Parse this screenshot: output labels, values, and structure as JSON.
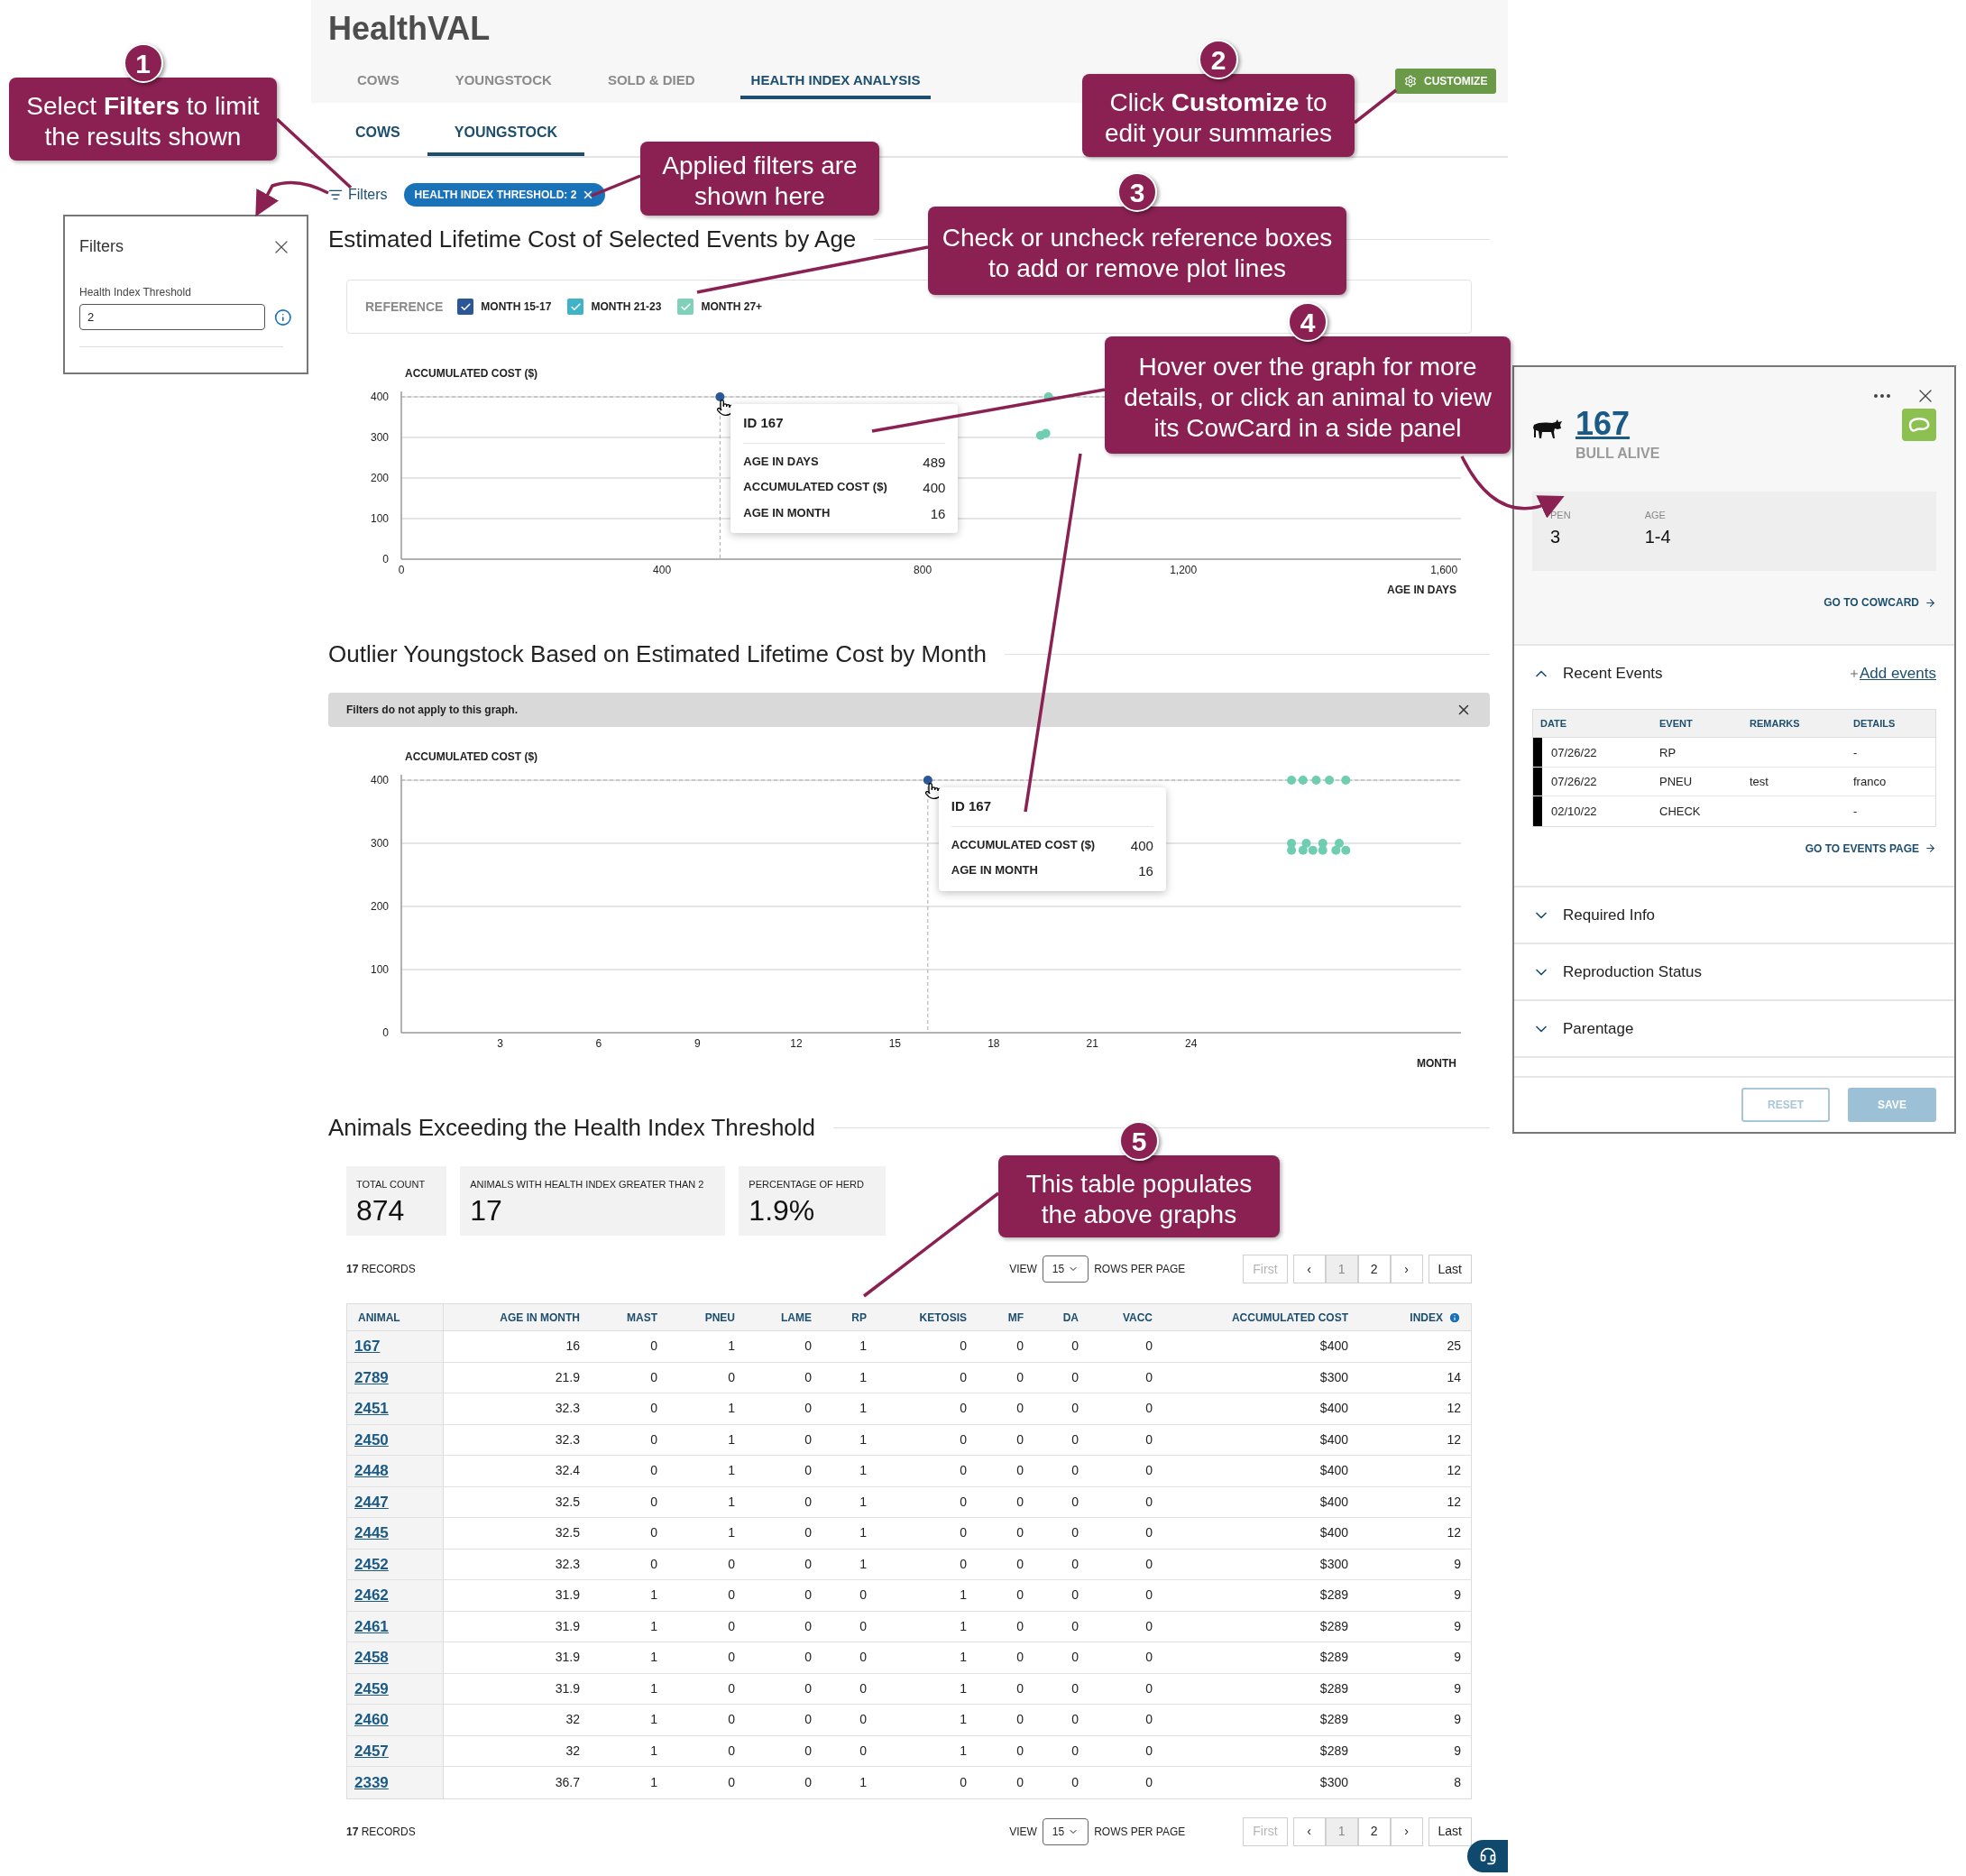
{
  "header": {
    "title": "HealthVAL",
    "customize": "CUSTOMIZE"
  },
  "tabs": [
    {
      "label": "COWS",
      "selected": false
    },
    {
      "label": "YOUNGSTOCK",
      "selected": false
    },
    {
      "label": "SOLD & DIED",
      "selected": false
    },
    {
      "label": "HEALTH INDEX ANALYSIS",
      "selected": true
    }
  ],
  "subtabs": [
    {
      "label": "COWS",
      "selected": false
    },
    {
      "label": "YOUNGSTOCK",
      "selected": true
    }
  ],
  "filter_bar": {
    "label": "Filters",
    "chips": [
      "HEALTH INDEX THRESHOLD: 2"
    ]
  },
  "filters_panel": {
    "title": "Filters",
    "field_label": "Health Index Threshold",
    "value": "2"
  },
  "age_chart": {
    "reference": {
      "label": "REFERENCE",
      "options": [
        {
          "label": "MONTH 15-17",
          "checked": true,
          "color": "#2b5797"
        },
        {
          "label": "MONTH 21-23",
          "checked": true,
          "color": "#3fb4c6"
        },
        {
          "label": "MONTH 27+",
          "checked": true,
          "color": "#7fd1b9"
        }
      ]
    },
    "chart_data": {
      "type": "scatter",
      "title": "Estimated Lifetime Cost of Selected Events by Age",
      "xlabel": "AGE IN DAYS",
      "ylabel": "ACCUMULATED COST ($)",
      "xlim": [
        0,
        1626
      ],
      "ylim": [
        0,
        400
      ],
      "grid": true,
      "ref_lines": [
        {
          "axis": "x",
          "value": 489
        },
        {
          "axis": "y",
          "value": 400
        }
      ],
      "xticks": [
        0,
        400,
        800,
        {
          "value": 1200,
          "label": "1,200"
        },
        {
          "value": 1600,
          "label": "1,600"
        }
      ],
      "yticks": [
        0,
        100,
        200,
        300,
        400
      ],
      "series": [
        {
          "color": "#2b5797",
          "x": [
            489
          ],
          "values": [
            400
          ]
        },
        {
          "color": "#6fcdb0",
          "x": [
            993,
            981,
            989
          ],
          "values": [
            400,
            305,
            310
          ]
        }
      ]
    },
    "tooltip": {
      "title": "ID 167",
      "rows": [
        {
          "label": "AGE IN DAYS",
          "value": "489"
        },
        {
          "label": "ACCUMULATED COST ($)",
          "value": "400"
        },
        {
          "label": "AGE IN MONTH",
          "value": "16"
        }
      ]
    }
  },
  "month_chart": {
    "notice": "Filters do not apply to this graph.",
    "chart_data": {
      "type": "scatter",
      "title": "Outlier Youngstock Based on Estimated Lifetime Cost by Month",
      "xlabel": "MONTH",
      "ylabel": "ACCUMULATED COST ($)",
      "xlim": [
        0,
        32.2
      ],
      "ylim": [
        0,
        400
      ],
      "grid": true,
      "ref_lines": [
        {
          "axis": "x",
          "value": 16
        },
        {
          "axis": "y",
          "value": 400
        }
      ],
      "xticks": [
        3,
        6,
        9,
        12,
        15,
        18,
        21,
        24
      ],
      "yticks": [
        0,
        100,
        200,
        300,
        400
      ],
      "series": [
        {
          "color": "#2b5797",
          "x": [
            16
          ],
          "values": [
            400
          ]
        },
        {
          "color": "#6fcdb0",
          "x": [
            27.05,
            27.4,
            27.8,
            28.2,
            28.7,
            27.05,
            27.5,
            28,
            28.5,
            27.05,
            27.4,
            27.7,
            28,
            28.4,
            28.7
          ],
          "values": [
            400,
            400,
            400,
            400,
            400,
            300,
            300,
            300,
            300,
            289,
            289,
            289,
            289,
            289,
            289
          ]
        }
      ]
    },
    "tooltip": {
      "title": "ID 167",
      "rows": [
        {
          "label": "ACCUMULATED COST ($)",
          "value": "400"
        },
        {
          "label": "AGE IN MONTH",
          "value": "16"
        }
      ]
    }
  },
  "threshold": {
    "title": "Animals Exceeding the Health Index Threshold",
    "stats": [
      {
        "label": "TOTAL COUNT",
        "value": "874"
      },
      {
        "label": "ANIMALS WITH HEALTH INDEX GREATER THAN 2",
        "value": "17"
      },
      {
        "label": "PERCENTAGE OF HERD",
        "value": "1.9%"
      }
    ],
    "pagers": [
      {
        "records": "**17** RECORDS",
        "view_label": "VIEW",
        "per_page": "15",
        "per_page_label": "ROWS PER PAGE",
        "buttons": [
          {
            "label": "First",
            "selected": false,
            "disabled": true
          },
          {
            "label": "‹",
            "selected": false,
            "disabled": false
          },
          {
            "label": "1",
            "selected": true,
            "disabled": false
          },
          {
            "label": "2",
            "selected": false,
            "disabled": false
          },
          {
            "label": "›",
            "selected": false,
            "disabled": false
          },
          {
            "label": "Last",
            "selected": false,
            "disabled": false
          }
        ]
      },
      {
        "records": "**17** RECORDS",
        "view_label": "VIEW",
        "per_page": "15",
        "per_page_label": "ROWS PER PAGE",
        "buttons": [
          {
            "label": "First",
            "selected": false,
            "disabled": true
          },
          {
            "label": "‹",
            "selected": false,
            "disabled": false
          },
          {
            "label": "1",
            "selected": true,
            "disabled": false
          },
          {
            "label": "2",
            "selected": false,
            "disabled": false
          },
          {
            "label": "›",
            "selected": false,
            "disabled": false
          },
          {
            "label": "Last",
            "selected": false,
            "disabled": false
          }
        ]
      }
    ],
    "columns": [
      "ANIMAL",
      "AGE IN MONTH",
      "MAST",
      "PNEU",
      "LAME",
      "RP",
      "KETOSIS",
      "MF",
      "DA",
      "VACC",
      "ACCUMULATED COST",
      "INDEX"
    ],
    "rows": [
      [
        "167",
        "16",
        "0",
        "1",
        "0",
        "1",
        "0",
        "0",
        "0",
        "0",
        "$400",
        "25"
      ],
      [
        "2789",
        "21.9",
        "0",
        "0",
        "0",
        "1",
        "0",
        "0",
        "0",
        "0",
        "$300",
        "14"
      ],
      [
        "2451",
        "32.3",
        "0",
        "1",
        "0",
        "1",
        "0",
        "0",
        "0",
        "0",
        "$400",
        "12"
      ],
      [
        "2450",
        "32.3",
        "0",
        "1",
        "0",
        "1",
        "0",
        "0",
        "0",
        "0",
        "$400",
        "12"
      ],
      [
        "2448",
        "32.4",
        "0",
        "1",
        "0",
        "1",
        "0",
        "0",
        "0",
        "0",
        "$400",
        "12"
      ],
      [
        "2447",
        "32.5",
        "0",
        "1",
        "0",
        "1",
        "0",
        "0",
        "0",
        "0",
        "$400",
        "12"
      ],
      [
        "2445",
        "32.5",
        "0",
        "1",
        "0",
        "1",
        "0",
        "0",
        "0",
        "0",
        "$400",
        "12"
      ],
      [
        "2452",
        "32.3",
        "0",
        "0",
        "0",
        "1",
        "0",
        "0",
        "0",
        "0",
        "$300",
        "9"
      ],
      [
        "2462",
        "31.9",
        "1",
        "0",
        "0",
        "0",
        "1",
        "0",
        "0",
        "0",
        "$289",
        "9"
      ],
      [
        "2461",
        "31.9",
        "1",
        "0",
        "0",
        "0",
        "1",
        "0",
        "0",
        "0",
        "$289",
        "9"
      ],
      [
        "2458",
        "31.9",
        "1",
        "0",
        "0",
        "0",
        "1",
        "0",
        "0",
        "0",
        "$289",
        "9"
      ],
      [
        "2459",
        "31.9",
        "1",
        "0",
        "0",
        "0",
        "1",
        "0",
        "0",
        "0",
        "$289",
        "9"
      ],
      [
        "2460",
        "32",
        "1",
        "0",
        "0",
        "0",
        "1",
        "0",
        "0",
        "0",
        "$289",
        "9"
      ],
      [
        "2457",
        "32",
        "1",
        "0",
        "0",
        "0",
        "1",
        "0",
        "0",
        "0",
        "$289",
        "9"
      ],
      [
        "2339",
        "36.7",
        "1",
        "0",
        "0",
        "1",
        "0",
        "0",
        "0",
        "0",
        "$300",
        "8"
      ]
    ]
  },
  "cowcard": {
    "id": "167",
    "status": "BULL ALIVE",
    "stats": [
      {
        "label": "PEN",
        "value": "3"
      },
      {
        "label": "AGE",
        "value": "1-4"
      }
    ],
    "cowcard_link": "GO TO COWCARD",
    "recent_events": {
      "title": "Recent Events",
      "expanded": true,
      "add_link": "Add events",
      "columns": [
        "DATE",
        "EVENT",
        "REMARKS",
        "DETAILS"
      ],
      "rows": [
        {
          "date": "07/26/22",
          "event": "RP",
          "details": "-"
        },
        {
          "date": "07/26/22",
          "event": "PNEU",
          "remarks": "test",
          "details": "franco"
        },
        {
          "date": "02/10/22",
          "event": "CHECK",
          "details": "-"
        }
      ],
      "events_link": "GO TO EVENTS PAGE"
    },
    "sections": [
      {
        "title": "Required Info",
        "expanded": false
      },
      {
        "title": "Reproduction Status",
        "expanded": false
      },
      {
        "title": "Parentage",
        "expanded": false
      }
    ],
    "buttons": [
      {
        "label": "RESET",
        "kind": "outline"
      },
      {
        "label": "SAVE",
        "kind": "primary"
      }
    ]
  },
  "annotations": [
    {
      "step": "1",
      "text": "Select **Filters** to limit the results shown"
    },
    {
      "text": "Applied filters are shown here"
    },
    {
      "step": "2",
      "text": "Click **Customize** to edit your summaries"
    },
    {
      "step": "3",
      "text": "Check or uncheck reference boxes to add or remove plot lines"
    },
    {
      "step": "4",
      "text": "Hover over the graph for more details, or click an animal to view its CowCard in a side panel"
    },
    {
      "step": "5",
      "text": "This table populates the above graphs"
    }
  ]
}
